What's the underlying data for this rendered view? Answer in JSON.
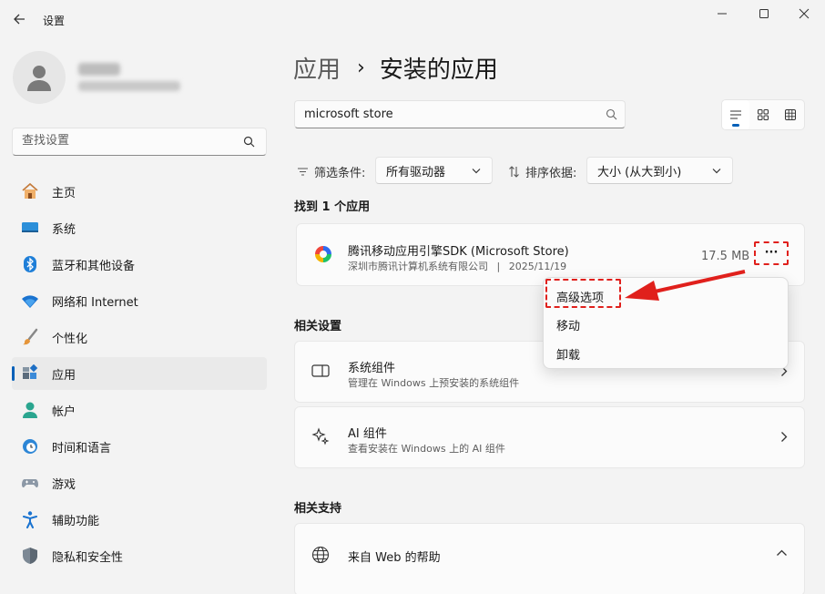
{
  "window": {
    "title": "设置",
    "back_icon": "arrow-left-icon",
    "min_icon": "minimize-icon",
    "max_icon": "maximize-icon",
    "close_icon": "close-icon"
  },
  "sidebar": {
    "search_placeholder": "查找设置",
    "items": [
      {
        "label": "主页",
        "icon": "home-icon"
      },
      {
        "label": "系统",
        "icon": "system-icon"
      },
      {
        "label": "蓝牙和其他设备",
        "icon": "bluetooth-icon"
      },
      {
        "label": "网络和 Internet",
        "icon": "wifi-icon"
      },
      {
        "label": "个性化",
        "icon": "brush-icon"
      },
      {
        "label": "应用",
        "icon": "apps-icon",
        "active": true
      },
      {
        "label": "帐户",
        "icon": "account-icon"
      },
      {
        "label": "时间和语言",
        "icon": "clock-globe-icon"
      },
      {
        "label": "游戏",
        "icon": "gamepad-icon"
      },
      {
        "label": "辅助功能",
        "icon": "accessibility-icon"
      },
      {
        "label": "隐私和安全性",
        "icon": "shield-icon"
      }
    ]
  },
  "main": {
    "breadcrumb_root": "应用",
    "breadcrumb_sep": "›",
    "page_title": "安装的应用",
    "search_value": "microsoft store",
    "filter_label": "筛选条件:",
    "filter_value": "所有驱动器",
    "sort_label": "排序依据:",
    "sort_value": "大小 (从大到小)",
    "found_text": "找到 1 个应用",
    "app": {
      "name": "腾讯移动应用引擎SDK (Microsoft Store)",
      "publisher": "深圳市腾讯计算机系统有限公司",
      "meta_sep": "|",
      "date": "2025/11/19",
      "size": "17.5 MB",
      "more_label": "···"
    },
    "related_settings_title": "相关设置",
    "related_settings": [
      {
        "title": "系统组件",
        "subtitle": "管理在 Windows 上预安装的系统组件",
        "icon": "system-component-icon"
      },
      {
        "title": "AI 组件",
        "subtitle": "查看安装在 Windows 上的 AI 组件",
        "icon": "sparkle-icon"
      }
    ],
    "related_support_title": "相关支持",
    "support_item": {
      "title": "来自 Web 的帮助",
      "icon": "globe-icon"
    }
  },
  "context_menu": {
    "items": [
      "高级选项",
      "移动",
      "卸载"
    ]
  },
  "colors": {
    "accent": "#005fb8",
    "annotation_red": "#e0201c",
    "background": "#f3f3f3",
    "card": "#fbfbfb"
  }
}
